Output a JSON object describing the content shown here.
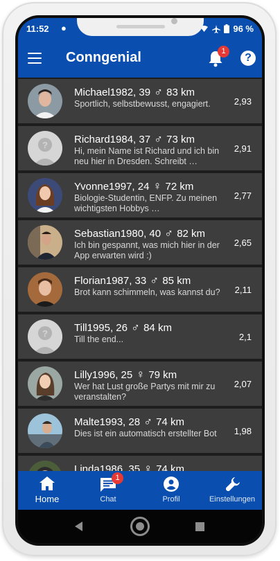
{
  "status_bar": {
    "time": "11:52",
    "battery": "96 %"
  },
  "app_bar": {
    "title": "Conngenial",
    "notification_count": "1"
  },
  "profiles": [
    {
      "name_age": "Michael1982, 39",
      "gender_symbol": "♂",
      "distance": "83 km",
      "description": "Sportlich, selbstbewusst, engagiert.",
      "score": "2,93",
      "avatar": "photo-man-dark-hair"
    },
    {
      "name_age": "Richard1984, 37",
      "gender_symbol": "♂",
      "distance": "73 km",
      "description": "Hi, mein Name ist Richard und ich bin neu hier in Dresden. Schreibt …",
      "score": "2,91",
      "avatar": "placeholder-avatar"
    },
    {
      "name_age": "Yvonne1997, 24",
      "gender_symbol": "♀",
      "distance": "72 km",
      "description": "Biologie-Studentin, ENFP. Zu meinen wichtigsten Hobbys …",
      "score": "2,77",
      "avatar": "photo-woman"
    },
    {
      "name_age": "Sebastian1980, 40",
      "gender_symbol": "♂",
      "distance": "82 km",
      "description": "Ich bin gespannt, was mich hier in der App erwarten wird :)",
      "score": "2,65",
      "avatar": "photo-man-suit"
    },
    {
      "name_age": "Florian1987, 33",
      "gender_symbol": "♂",
      "distance": "85 km",
      "description": "Brot kann schimmeln, was kannst du?",
      "score": "2,11",
      "avatar": "photo-man-young"
    },
    {
      "name_age": "Till1995, 26",
      "gender_symbol": "♂",
      "distance": "84 km",
      "description": "Till the end...",
      "score": "2,1",
      "avatar": "placeholder-avatar"
    },
    {
      "name_age": "Lilly1996, 25",
      "gender_symbol": "♀",
      "distance": "79 km",
      "description": "Wer hat Lust große Partys mit mir zu veranstalten?",
      "score": "2,07",
      "avatar": "photo-woman-smiling"
    },
    {
      "name_age": "Malte1993, 28",
      "gender_symbol": "♂",
      "distance": "74 km",
      "description": "Dies ist ein automatisch erstellter Bot",
      "score": "1,98",
      "avatar": "photo-man-car"
    },
    {
      "name_age": "Linda1986, 35",
      "gender_symbol": "♀",
      "distance": "74 km",
      "description": "",
      "score": "",
      "avatar": "photo-woman-partial"
    }
  ],
  "bottom_nav": [
    {
      "label": "Home",
      "icon": "home-icon",
      "active": true
    },
    {
      "label": "Chat",
      "icon": "chat-icon",
      "badge": "1"
    },
    {
      "label": "Profil",
      "icon": "profile-icon"
    },
    {
      "label": "Einstellungen",
      "icon": "wrench-icon"
    }
  ],
  "colors": {
    "primary": "#0a4fb0",
    "row_bg": "#3d3d3d",
    "badge": "#e53935"
  }
}
